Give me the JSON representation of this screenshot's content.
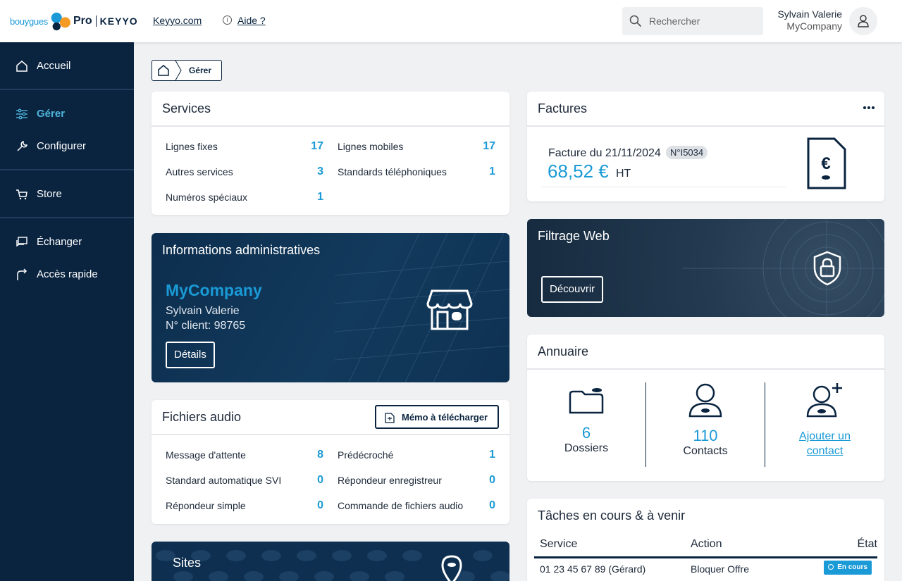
{
  "header": {
    "brand_bouygues": "bouygues",
    "brand_pro": "Pro",
    "brand_keyyo": "KEYYO",
    "keyyo_link": "Keyyo.com",
    "aide_link": "Aide ?",
    "search_placeholder": "Rechercher",
    "user_name": "Sylvain Valerie",
    "user_company": "MyCompany"
  },
  "sidebar": {
    "items": [
      {
        "label": "Accueil",
        "icon": "home-icon"
      },
      {
        "label": "Gérer",
        "icon": "sliders-icon",
        "active": true
      },
      {
        "label": "Configurer",
        "icon": "wrench-icon"
      },
      {
        "label": "Store",
        "icon": "cart-icon"
      },
      {
        "label": "Échanger",
        "icon": "chat-icon"
      },
      {
        "label": "Accès rapide",
        "icon": "shortcut-icon"
      }
    ]
  },
  "breadcrumb": {
    "current": "Gérer"
  },
  "services": {
    "title": "Services",
    "items": [
      {
        "label": "Lignes fixes",
        "value": "17"
      },
      {
        "label": "Lignes mobiles",
        "value": "17"
      },
      {
        "label": "Autres services",
        "value": "3"
      },
      {
        "label": "Standards téléphoniques",
        "value": "1"
      },
      {
        "label": "Numéros spéciaux",
        "value": "1"
      }
    ]
  },
  "admin": {
    "title": "Informations administratives",
    "company": "MyCompany",
    "contact": "Sylvain Valerie",
    "client": "N° client: 98765",
    "details_button": "Détails"
  },
  "audio": {
    "title": "Fichiers audio",
    "memo_button": "Mémo à télécharger",
    "items": [
      {
        "label": "Message d'attente",
        "value": "8"
      },
      {
        "label": "Prédécroché",
        "value": "1"
      },
      {
        "label": "Standard automatique SVI",
        "value": "0"
      },
      {
        "label": "Répondeur enregistreur",
        "value": "0"
      },
      {
        "label": "Répondeur simple",
        "value": "0"
      },
      {
        "label": "Commande de fichiers audio",
        "value": "0"
      }
    ]
  },
  "sites": {
    "title": "Sites"
  },
  "factures": {
    "title": "Factures",
    "invoice_date": "Facture du 21/11/2024",
    "invoice_number": "N°I5034",
    "amount": "68,52 €",
    "amount_suffix": "HT"
  },
  "filtrage": {
    "title": "Filtrage Web",
    "discover_button": "Découvrir"
  },
  "annuaire": {
    "title": "Annuaire",
    "dossiers_count": "6",
    "dossiers_label": "Dossiers",
    "contacts_count": "110",
    "contacts_label": "Contacts",
    "add_contact_line1": "Ajouter un",
    "add_contact_line2": "contact"
  },
  "tasks": {
    "title": "Tâches en cours & à venir",
    "col_service": "Service",
    "col_action": "Action",
    "col_state": "État",
    "rows": [
      {
        "service": "01 23 45 67 89 (Gérard)",
        "action": "Bloquer Offre",
        "state": "En cours"
      }
    ]
  },
  "colors": {
    "accent": "#1a9ad6",
    "navy": "#0a2440"
  }
}
